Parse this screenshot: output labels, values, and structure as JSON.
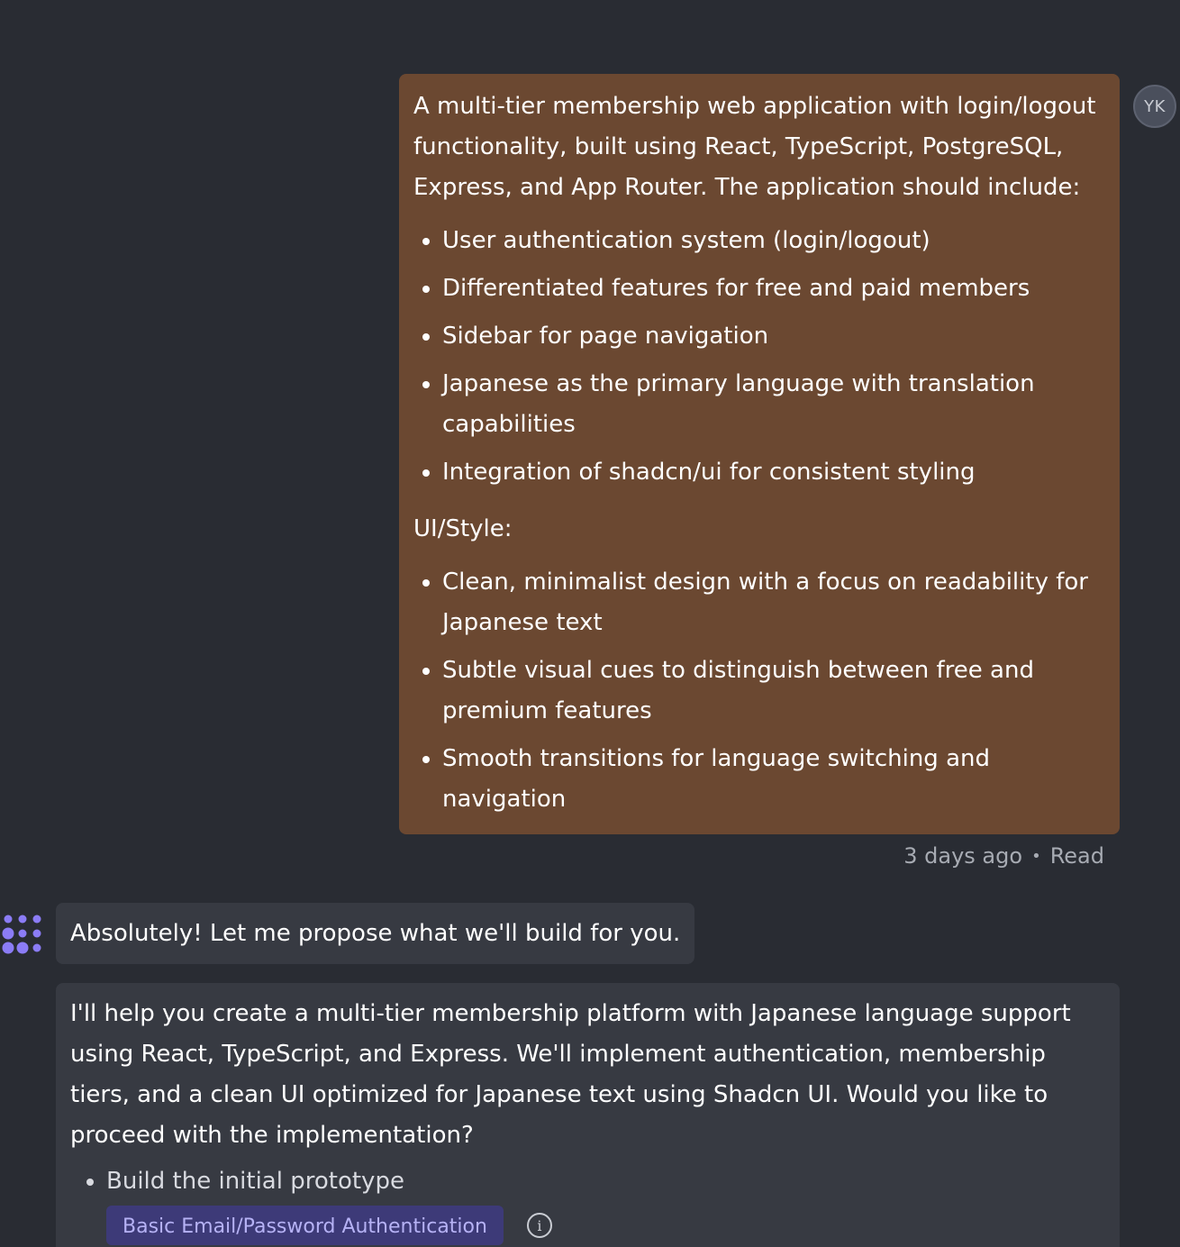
{
  "user_message": {
    "avatar_initials": "YK",
    "intro": "A multi-tier membership web application with login/logout functionality, built using React, TypeScript, PostgreSQL, Express, and App Router. The application should include:",
    "features": [
      "User authentication system (login/logout)",
      "Differentiated features for free and paid members",
      "Sidebar for page navigation",
      "Japanese as the primary language with translation capabilities",
      "Integration of shadcn/ui for consistent styling"
    ],
    "style_label": "UI/Style:",
    "style_items": [
      "Clean, minimalist design with a focus on readability for Japanese text",
      "Subtle visual cues to distinguish between free and premium features",
      "Smooth transitions for language switching and navigation"
    ],
    "timestamp": "3 days ago",
    "status": "Read"
  },
  "assistant": {
    "greeting": "Absolutely! Let me propose what we'll build for you.",
    "proposal": "I'll help you create a multi-tier membership platform with Japanese language support using React, TypeScript, and Express. We'll implement authentication, membership tiers, and a clean UI optimized for Japanese text using Shadcn UI. Would you like to proceed with the implementation?",
    "steps": [
      "Build the initial prototype"
    ],
    "tags": [
      "Basic Email/Password Authentication"
    ]
  },
  "colors": {
    "background": "#292c33",
    "user_bubble": "#6b4831",
    "assistant_bubble": "#373a42",
    "tag_background": "#3d3a78",
    "logo": "#8b7cf6"
  },
  "icons": {
    "assistant_logo": "dots-logo-icon",
    "info": "info-icon"
  }
}
